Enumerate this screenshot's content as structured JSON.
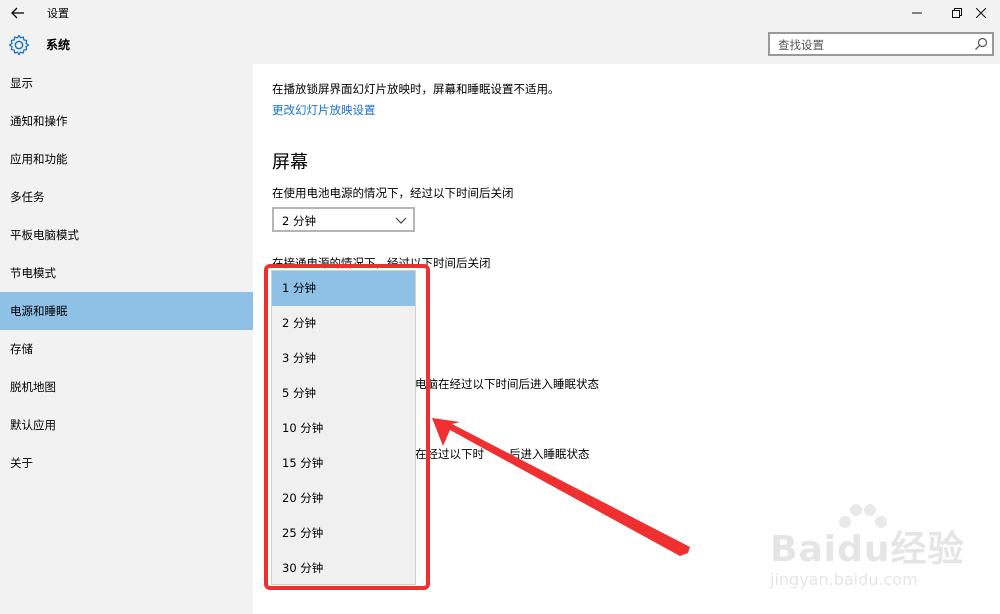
{
  "window": {
    "title": "设置",
    "back_icon": "back-arrow-icon",
    "controls": [
      "minimize-icon",
      "restore-icon",
      "close-icon"
    ]
  },
  "header": {
    "title": "系统",
    "icon": "gear-icon",
    "search_placeholder": "查找设置"
  },
  "sidebar": {
    "items": [
      {
        "label": "显示"
      },
      {
        "label": "通知和操作"
      },
      {
        "label": "应用和功能"
      },
      {
        "label": "多任务"
      },
      {
        "label": "平板电脑模式"
      },
      {
        "label": "节电模式"
      },
      {
        "label": "电源和睡眠",
        "selected": true
      },
      {
        "label": "存储"
      },
      {
        "label": "脱机地图"
      },
      {
        "label": "默认应用"
      },
      {
        "label": "关于"
      }
    ]
  },
  "main": {
    "note": "在播放锁屏界面幻灯片放映时，屏幕和睡眠设置不适用。",
    "slideshow_link": "更改幻灯片放映设置",
    "screen_heading": "屏幕",
    "battery_label": "在使用电池电源的情况下，经过以下时间后关闭",
    "battery_value": "2 分钟",
    "plugged_label": "在接通电源的情况下，经过以下时间后关闭",
    "sleep_battery_label_partial": "电脑在经过以下时间后进入睡眠状态",
    "sleep_plugged_label_partial_a": "在经过以下时",
    "sleep_plugged_label_partial_b": "后进入睡眠状态"
  },
  "dropdown": {
    "options": [
      {
        "label": "1 分钟",
        "selected": true
      },
      {
        "label": "2 分钟"
      },
      {
        "label": "3 分钟"
      },
      {
        "label": "5 分钟"
      },
      {
        "label": "10 分钟"
      },
      {
        "label": "15 分钟"
      },
      {
        "label": "20 分钟"
      },
      {
        "label": "25 分钟"
      },
      {
        "label": "30 分钟"
      }
    ]
  },
  "annotation": {
    "color": "#f03030"
  },
  "watermark": {
    "brand": "Baidu经验",
    "url": "jingyan.baidu.com"
  }
}
